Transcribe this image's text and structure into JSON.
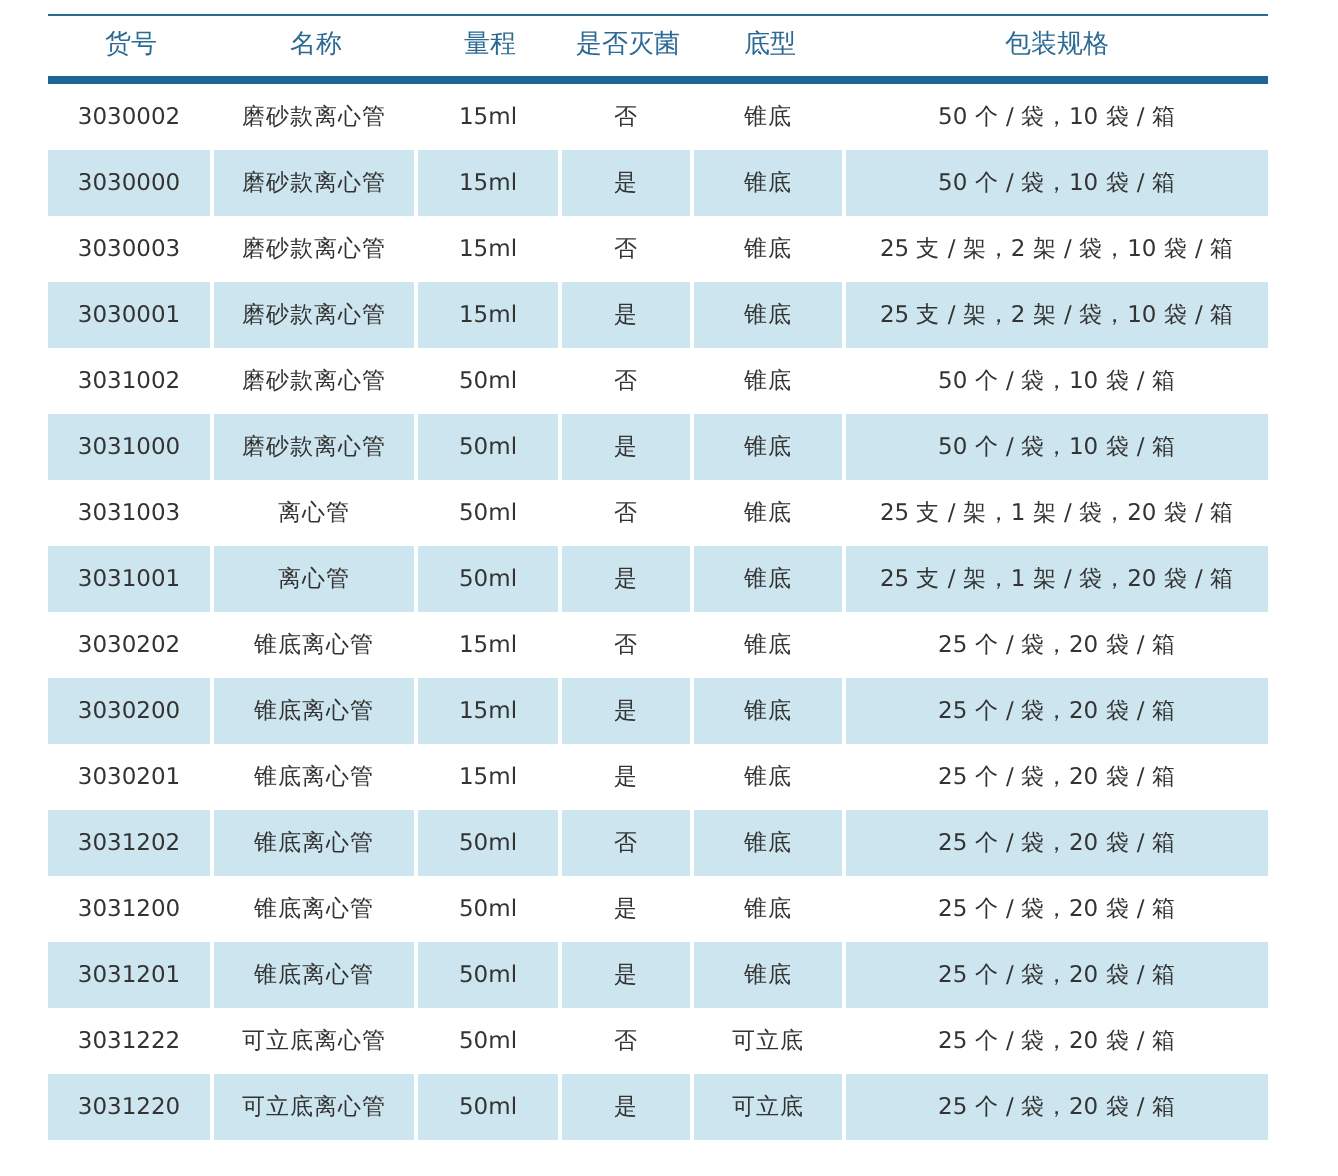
{
  "table": {
    "columns": [
      "货号",
      "名称",
      "量程",
      "是否灭菌",
      "底型",
      "包装规格"
    ],
    "rows": [
      [
        "3030002",
        "磨砂款离心管",
        "15ml",
        "否",
        "锥底",
        "50 个 / 袋，10 袋 / 箱"
      ],
      [
        "3030000",
        "磨砂款离心管",
        "15ml",
        "是",
        "锥底",
        "50 个 / 袋，10 袋 / 箱"
      ],
      [
        "3030003",
        "磨砂款离心管",
        "15ml",
        "否",
        "锥底",
        "25 支 / 架，2 架 / 袋，10 袋 / 箱"
      ],
      [
        "3030001",
        "磨砂款离心管",
        "15ml",
        "是",
        "锥底",
        "25 支 / 架，2 架 / 袋，10 袋 / 箱"
      ],
      [
        "3031002",
        "磨砂款离心管",
        "50ml",
        "否",
        "锥底",
        "50 个 / 袋，10 袋 / 箱"
      ],
      [
        "3031000",
        "磨砂款离心管",
        "50ml",
        "是",
        "锥底",
        "50 个 / 袋，10 袋 / 箱"
      ],
      [
        "3031003",
        "离心管",
        "50ml",
        "否",
        "锥底",
        "25 支 / 架，1 架 / 袋，20 袋 / 箱"
      ],
      [
        "3031001",
        "离心管",
        "50ml",
        "是",
        "锥底",
        "25 支 / 架，1 架 / 袋，20 袋 / 箱"
      ],
      [
        "3030202",
        "锥底离心管",
        "15ml",
        "否",
        "锥底",
        "25 个 / 袋，20 袋 / 箱"
      ],
      [
        "3030200",
        "锥底离心管",
        "15ml",
        "是",
        "锥底",
        "25 个 / 袋，20 袋 / 箱"
      ],
      [
        "3030201",
        "锥底离心管",
        "15ml",
        "是",
        "锥底",
        "25 个 / 袋，20 袋 / 箱"
      ],
      [
        "3031202",
        "锥底离心管",
        "50ml",
        "否",
        "锥底",
        "25 个 / 袋，20 袋 / 箱"
      ],
      [
        "3031200",
        "锥底离心管",
        "50ml",
        "是",
        "锥底",
        "25 个 / 袋，20 袋 / 箱"
      ],
      [
        "3031201",
        "锥底离心管",
        "50ml",
        "是",
        "锥底",
        "25 个 / 袋，20 袋 / 箱"
      ],
      [
        "3031222",
        "可立底离心管",
        "50ml",
        "否",
        "可立底",
        "25 个 / 袋，20 袋 / 箱"
      ],
      [
        "3031220",
        "可立底离心管",
        "50ml",
        "是",
        "可立底",
        "25 个 / 袋，20 袋 / 箱"
      ]
    ]
  }
}
